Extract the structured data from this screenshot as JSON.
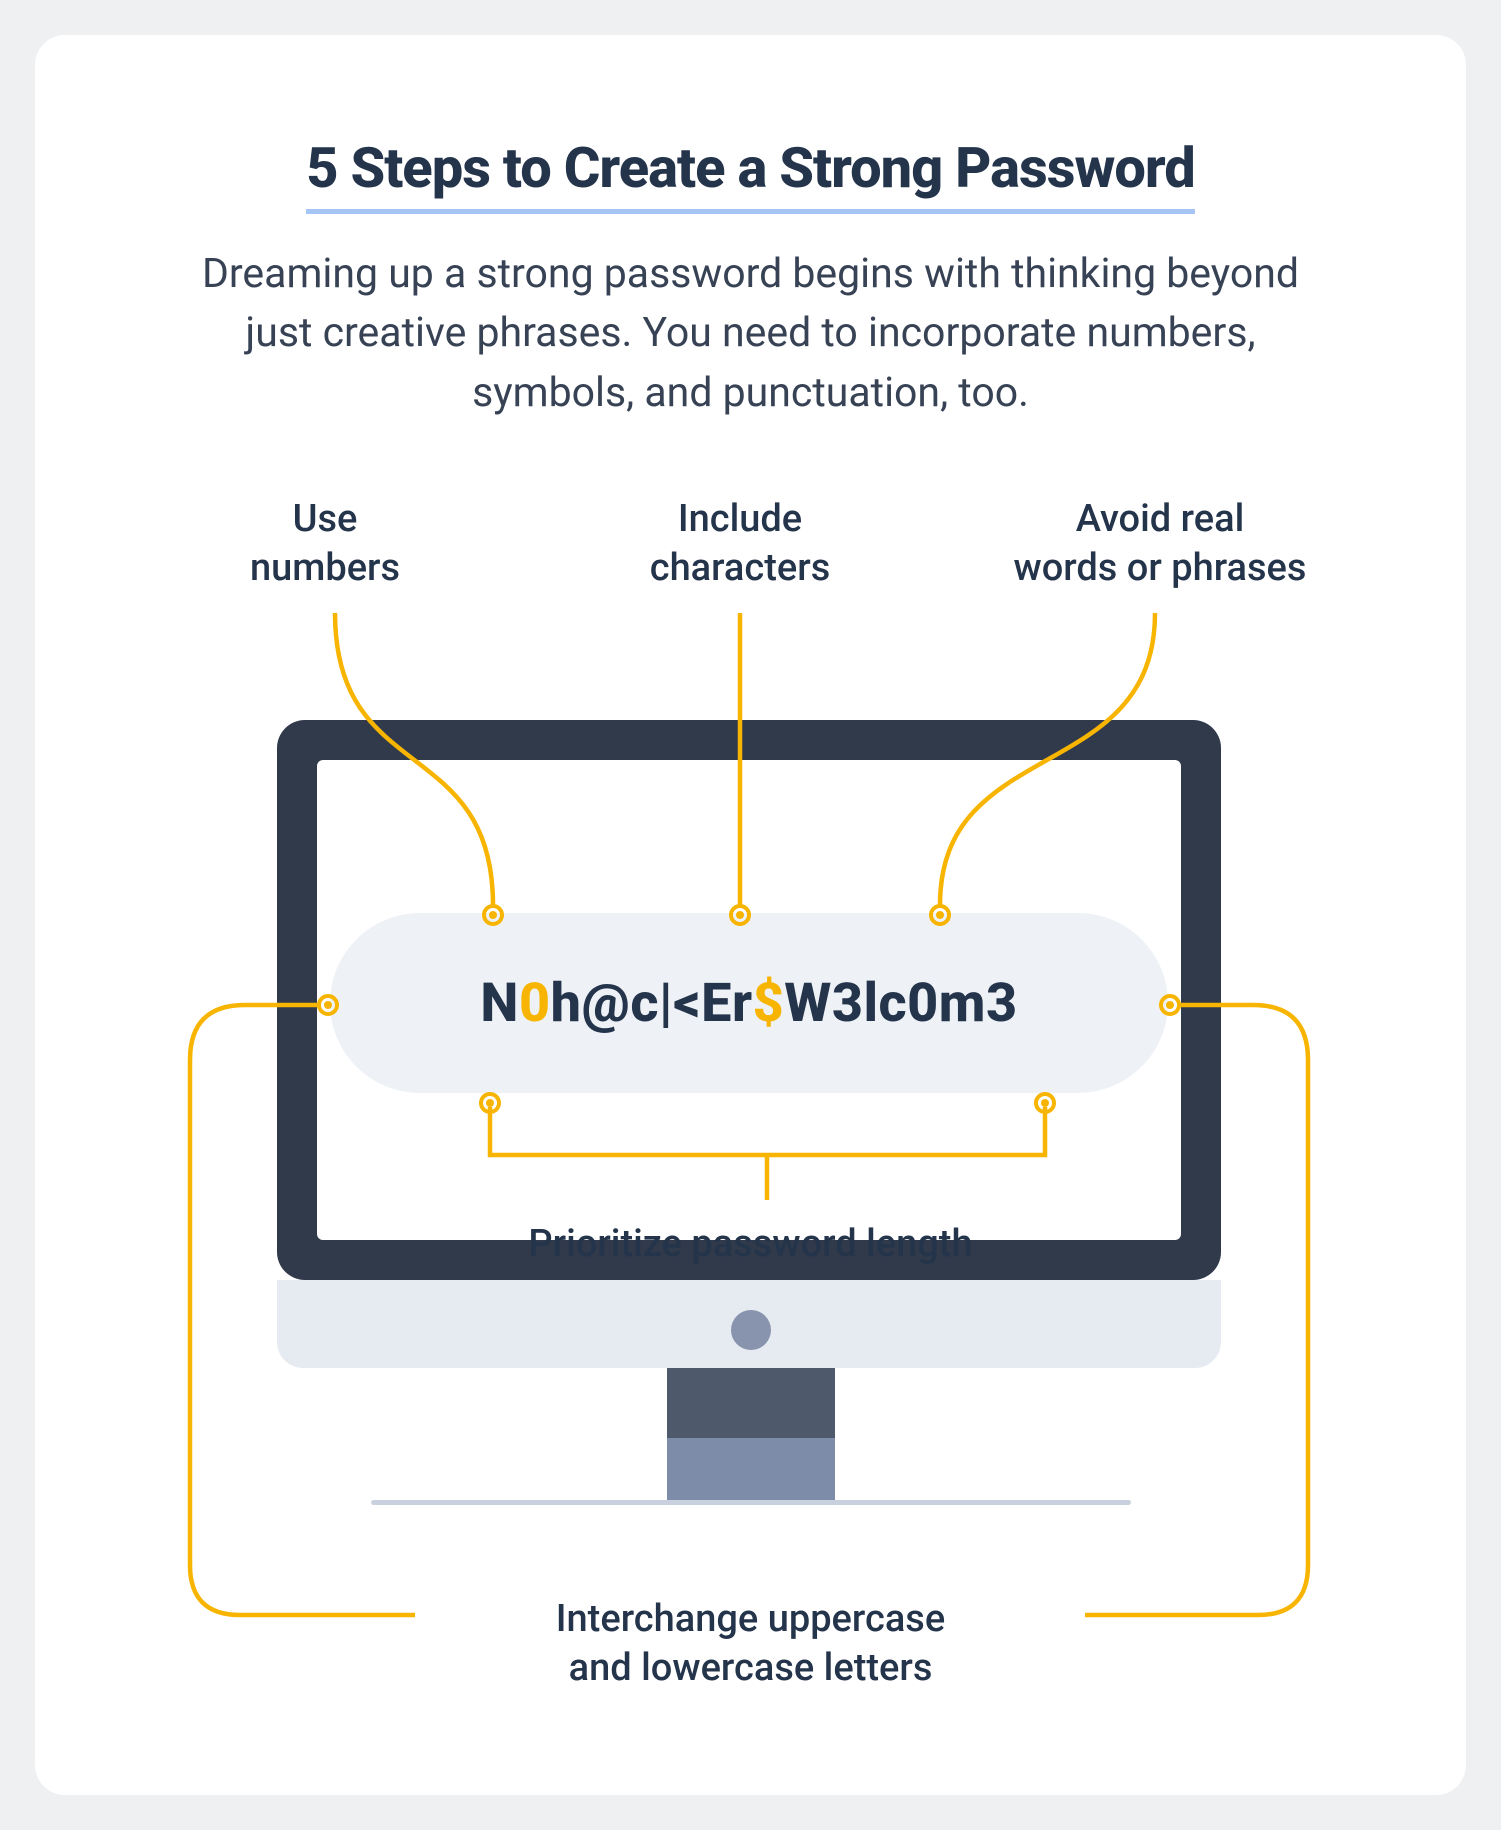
{
  "title": "5 Steps to Create a Strong Password",
  "subtitle": "Dreaming up a strong password begins with thinking beyond just creative phrases. You need to incorporate numbers, symbols, and punctuation, too.",
  "callouts": {
    "numbers_l1": "Use",
    "numbers_l2": "numbers",
    "chars_l1": "Include",
    "chars_l2": "characters",
    "avoid_l1": "Avoid real",
    "avoid_l2": "words or phrases",
    "length": "Prioritize password length",
    "case_l1": "Interchange uppercase",
    "case_l2": "and lowercase letters"
  },
  "password": {
    "seg1": "N",
    "hl1": "0",
    "seg2": "h@c|<Er",
    "hl2": "$",
    "seg3": "W3lc0m3"
  },
  "colors": {
    "accent": "#F7B400",
    "heading": "#24344B",
    "underline": "#A5C5F6",
    "bezel": "#303A4A"
  }
}
